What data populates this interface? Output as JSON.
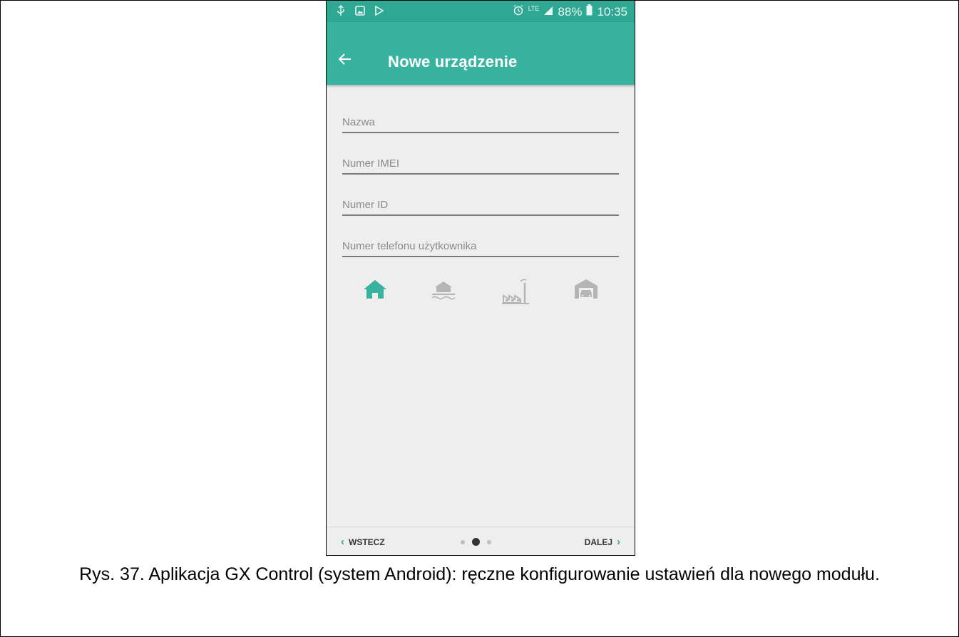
{
  "status_bar": {
    "battery": "88%",
    "time": "10:35",
    "network": "LTE",
    "left_icons": [
      "usb-icon",
      "image-icon",
      "play-store-icon"
    ],
    "right_icons": [
      "alarm-icon",
      "lte-icon",
      "signal-icon",
      "battery-icon"
    ]
  },
  "app_bar": {
    "title": "Nowe urządzenie",
    "back_icon": "back-arrow-icon"
  },
  "form": {
    "name_placeholder": "Nazwa",
    "imei_placeholder": "Numer IMEI",
    "id_placeholder": "Numer ID",
    "phone_placeholder": "Numer telefonu użytkownika"
  },
  "object_types": [
    {
      "icon": "house-icon",
      "selected": true
    },
    {
      "icon": "lake-house-icon",
      "selected": false
    },
    {
      "icon": "factory-icon",
      "selected": false
    },
    {
      "icon": "garage-icon",
      "selected": false
    }
  ],
  "colors": {
    "accent": "#37b3a0",
    "status_bar": "#2ea892",
    "icon_active": "#37b3a0",
    "icon_inactive": "#b5b5b5"
  },
  "bottom_nav": {
    "back_label": "WSTECZ",
    "next_label": "DALEJ",
    "page_count": 3,
    "active_page": 2
  },
  "caption": "Rys. 37. Aplikacja GX Control (system Android): ręczne konfigurowanie ustawień dla nowego modułu."
}
